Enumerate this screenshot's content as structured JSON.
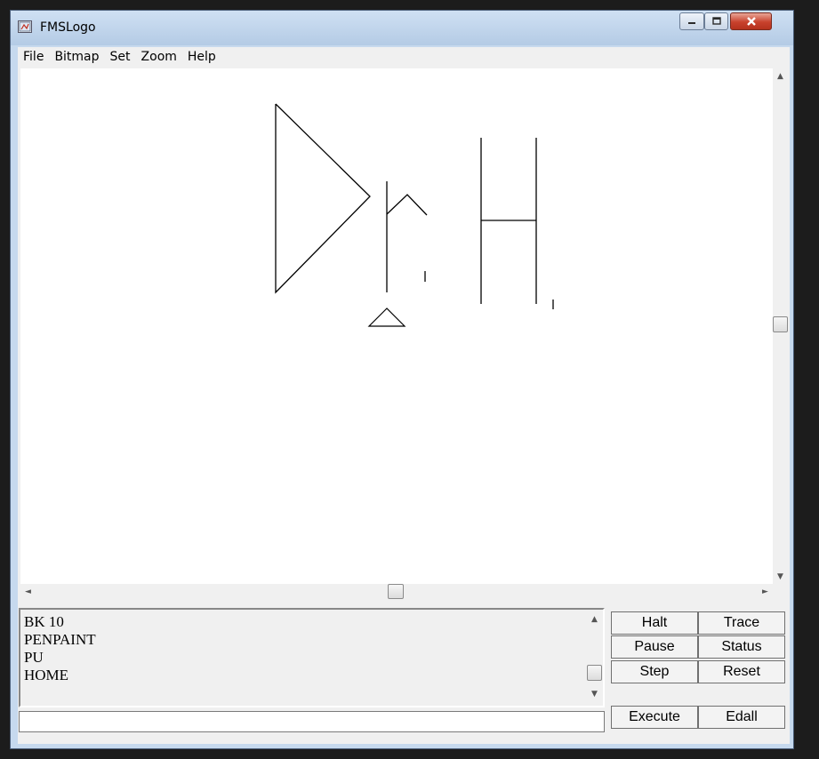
{
  "window": {
    "title": "FMSLogo"
  },
  "menu": {
    "items": [
      "File",
      "Bitmap",
      "Set",
      "Zoom",
      "Help"
    ]
  },
  "scroll": {
    "up": "▲",
    "down": "▼",
    "left": "◄",
    "right": "►"
  },
  "commander": {
    "history": [
      "BK 10",
      "PENPAINT",
      "PU",
      "HOME"
    ],
    "input_value": "",
    "buttons": {
      "halt": "Halt",
      "trace": "Trace",
      "pause": "Pause",
      "status": "Status",
      "step": "Step",
      "reset": "Reset",
      "execute": "Execute",
      "edall": "Edall"
    }
  },
  "icons": {
    "app": "logo-window-icon",
    "minimize": "minimize-icon",
    "maximize": "maximize-icon",
    "close": "close-icon",
    "turtle": "turtle-triangle-icon"
  },
  "colors": {
    "title_gradient_top": "#cfe0f3",
    "close_button": "#c8412c",
    "canvas_background": "#ffffff",
    "pen": "#000000"
  }
}
